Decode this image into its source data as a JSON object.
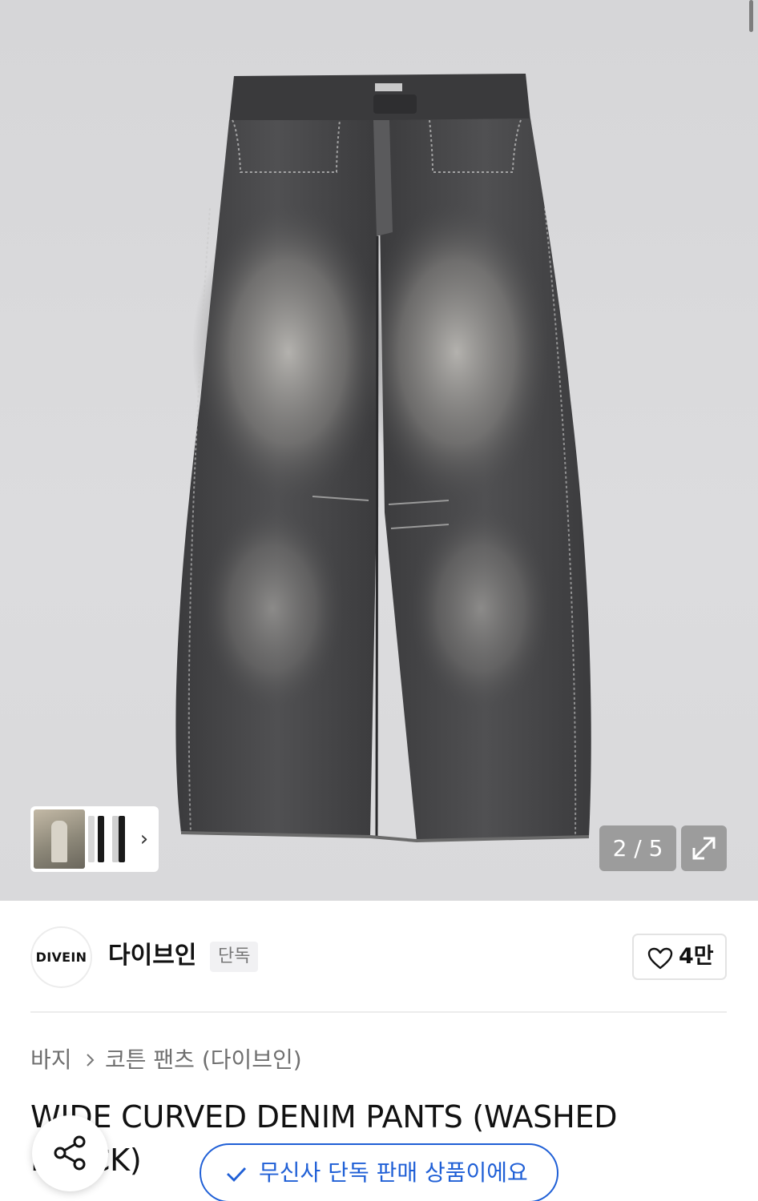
{
  "gallery": {
    "image_alt": "",
    "counter": "2 / 5",
    "thumb_chevron": "›",
    "expand_icon": "expand-icon"
  },
  "brand": {
    "logo_text": "DIVEIN",
    "name": "다이브인",
    "badge": "단독",
    "like_count": "4만"
  },
  "breadcrumb": {
    "category": "바지",
    "subcategory": "코튼 팬츠 (다이브인)"
  },
  "product": {
    "title": "WIDE CURVED DENIM PANTS (WASHED BLACK)"
  },
  "floating": {
    "exclusive_label": "무신사 단독 판매 상품이에요"
  },
  "colors": {
    "accent": "#1f5fd6",
    "hero_bg": "#d9d9db"
  }
}
